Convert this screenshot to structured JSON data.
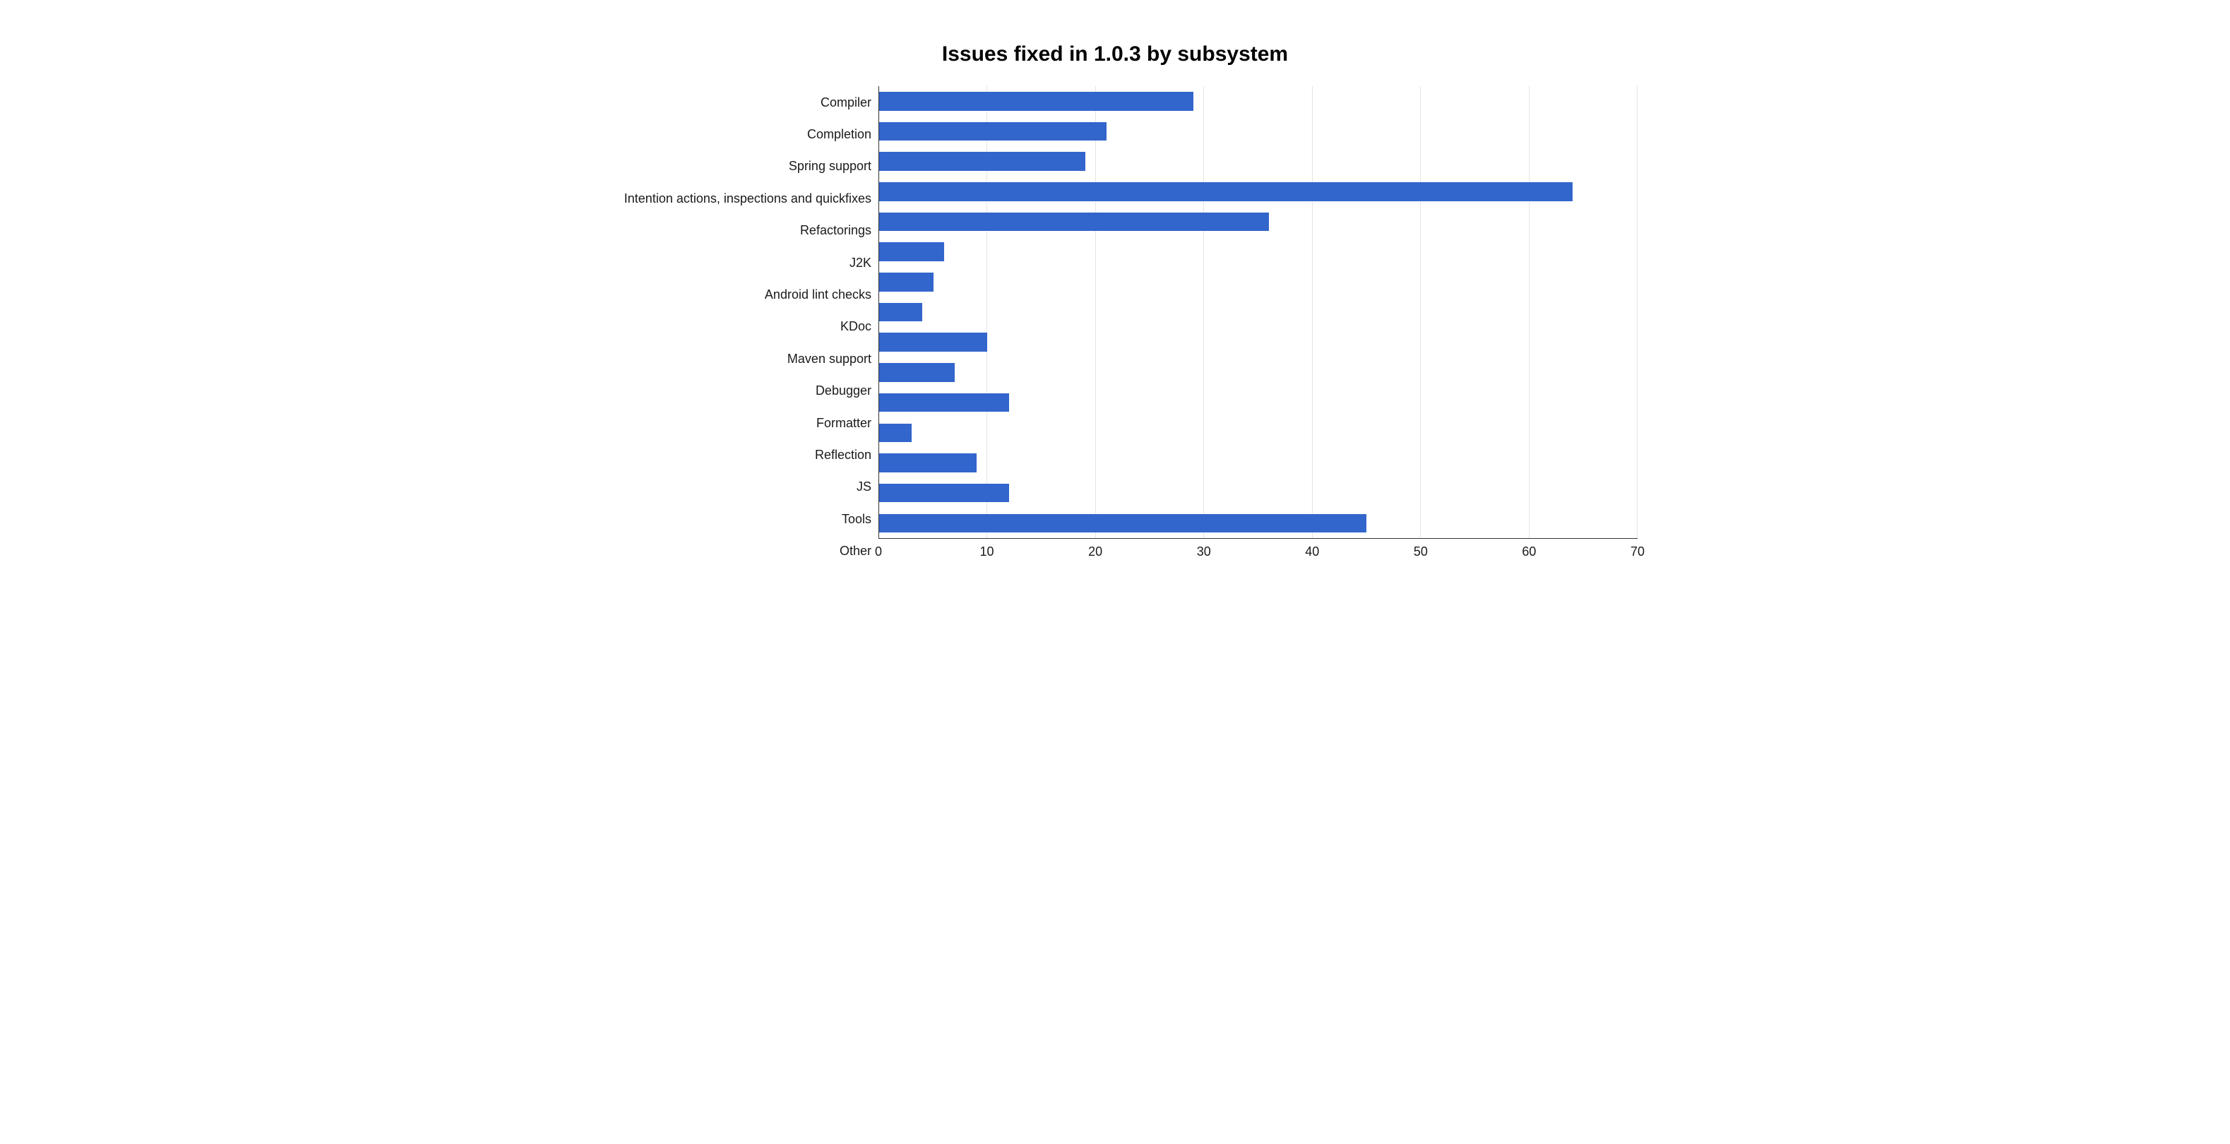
{
  "chart_data": {
    "type": "bar",
    "orientation": "horizontal",
    "title": "Issues fixed in 1.0.3 by subsystem",
    "xlabel": "",
    "ylabel": "",
    "xlim": [
      0,
      70
    ],
    "x_ticks": [
      0,
      10,
      20,
      30,
      40,
      50,
      60,
      70
    ],
    "categories": [
      "Compiler",
      "Completion",
      "Spring support",
      "Intention actions, inspections and quickfixes",
      "Refactorings",
      "J2K",
      "Android lint checks",
      "KDoc",
      "Maven support",
      "Debugger",
      "Formatter",
      "Reflection",
      "JS",
      "Tools",
      "Other"
    ],
    "values": [
      29,
      21,
      19,
      64,
      36,
      6,
      5,
      4,
      10,
      7,
      12,
      3,
      9,
      12,
      45
    ],
    "bar_color": "#3366cc",
    "grid": true
  }
}
